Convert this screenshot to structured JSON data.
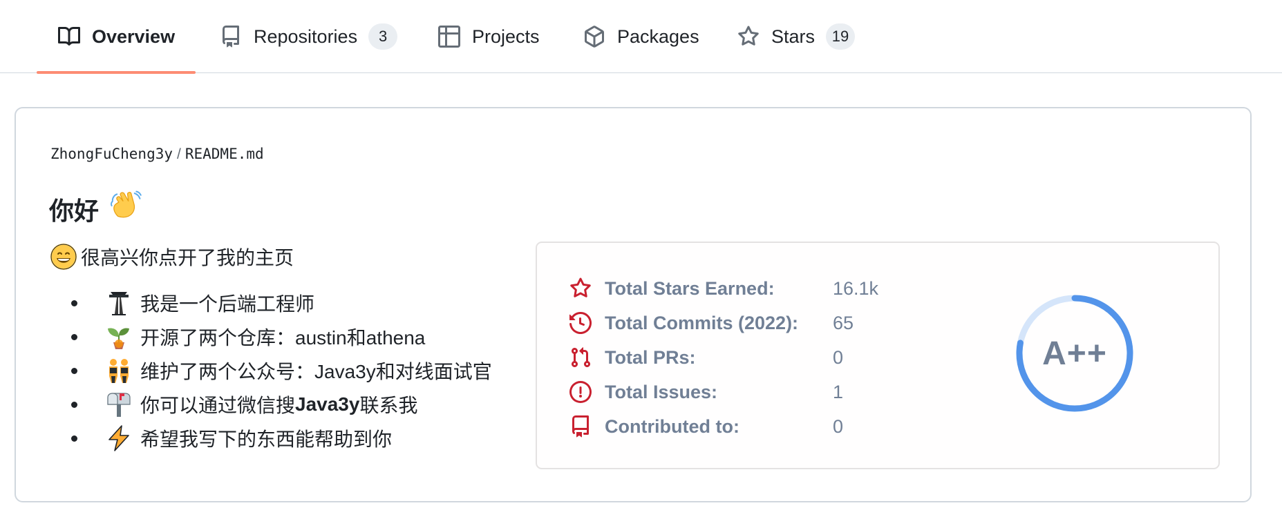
{
  "tabs": [
    {
      "label": "Overview",
      "icon": "book-icon",
      "selected": true
    },
    {
      "label": "Repositories",
      "icon": "repo-icon",
      "count": "3"
    },
    {
      "label": "Projects",
      "icon": "table-icon"
    },
    {
      "label": "Packages",
      "icon": "package-icon"
    },
    {
      "label": "Stars",
      "icon": "star-icon",
      "count": "19"
    }
  ],
  "readme": {
    "owner": "ZhongFuCheng3y",
    "separator": "/",
    "filename": "README.md",
    "greeting": "你好",
    "greeting_emoji": "waving-hand",
    "intro": "很高兴你点开了我的主页",
    "intro_emoji": "grinning-face",
    "bullets": [
      {
        "icon": "construction-worker",
        "text": "我是一个后端工程师"
      },
      {
        "icon": "seedling",
        "text": "开源了两个仓库：austin和athena"
      },
      {
        "icon": "twins",
        "text": "维护了两个公众号：Java3y和对线面试官"
      },
      {
        "icon": "mailbox",
        "text_before": "你可以通过微信搜",
        "text_bold": "Java3y",
        "text_after": "联系我"
      },
      {
        "icon": "lightning",
        "text": "希望我写下的东西能帮助到你"
      }
    ]
  },
  "stats": {
    "accent_color": "#c9202f",
    "text_color": "#707f95",
    "rows": [
      {
        "icon": "star-icon",
        "label": "Total Stars Earned:",
        "value": "16.1k"
      },
      {
        "icon": "history-icon",
        "label": "Total Commits (2022):",
        "value": "65"
      },
      {
        "icon": "pull-request-icon",
        "label": "Total PRs:",
        "value": "0"
      },
      {
        "icon": "issue-icon",
        "label": "Total Issues:",
        "value": "1"
      },
      {
        "icon": "repo-icon",
        "label": "Contributed to:",
        "value": "0"
      }
    ],
    "rank": "A++",
    "rank_progress": 0.78,
    "ring_color": "#5394ea",
    "ring_track_color": "#d5e5fa"
  }
}
